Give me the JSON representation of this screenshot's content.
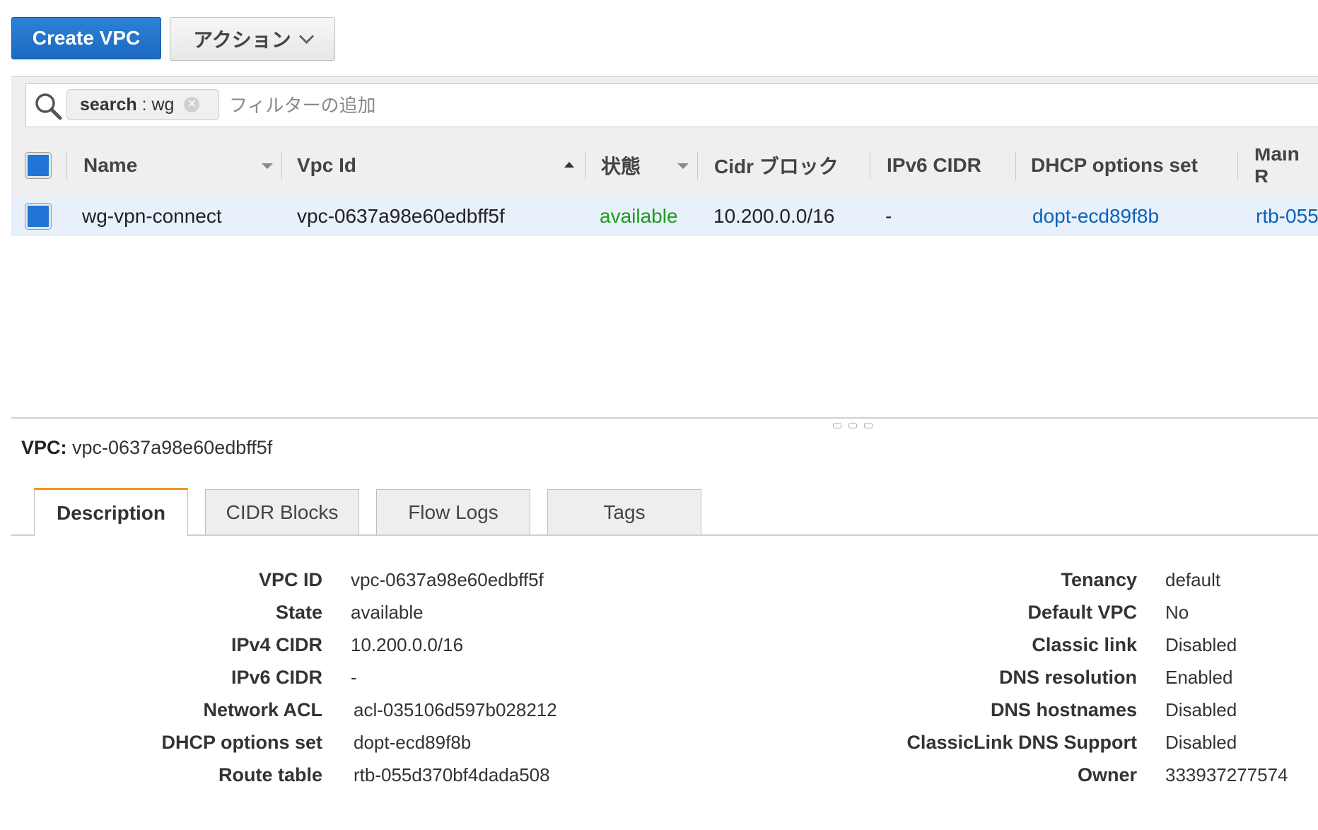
{
  "toolbar": {
    "create_label": "Create VPC",
    "actions_label": "アクション"
  },
  "search": {
    "chip_key": "search",
    "chip_sep": " : ",
    "chip_value": "wg",
    "placeholder": "フィルターの追加"
  },
  "table": {
    "columns": [
      "Name",
      "Vpc Id",
      "状態",
      "Cidr ブロック",
      "IPv6 CIDR",
      "DHCP options set",
      "Main R"
    ],
    "rows": [
      {
        "name": "wg-vpn-connect",
        "vpc_id": "vpc-0637a98e60edbff5f",
        "state": "available",
        "cidr": "10.200.0.0/16",
        "ipv6": "-",
        "dhcp": "dopt-ecd89f8b",
        "main_rt": "rtb-055"
      }
    ]
  },
  "detail": {
    "title_label": "VPC:",
    "title_value": "vpc-0637a98e60edbff5f",
    "tabs": [
      "Description",
      "CIDR Blocks",
      "Flow Logs",
      "Tags"
    ],
    "left": [
      {
        "label": "VPC ID",
        "value": "vpc-0637a98e60edbff5f"
      },
      {
        "label": "State",
        "value": "available"
      },
      {
        "label": "IPv4 CIDR",
        "value": "10.200.0.0/16"
      },
      {
        "label": "IPv6 CIDR",
        "value": "-"
      },
      {
        "label": "Network ACL",
        "value": "acl-035106d597b028212"
      },
      {
        "label": "DHCP options set",
        "value": "dopt-ecd89f8b"
      },
      {
        "label": "Route table",
        "value": "rtb-055d370bf4dada508"
      }
    ],
    "right": [
      {
        "label": "Tenancy",
        "value": "default"
      },
      {
        "label": "Default VPC",
        "value": "No"
      },
      {
        "label": "Classic link",
        "value": "Disabled"
      },
      {
        "label": "DNS resolution",
        "value": "Enabled"
      },
      {
        "label": "DNS hostnames",
        "value": "Disabled"
      },
      {
        "label": "ClassicLink DNS Support",
        "value": "Disabled"
      },
      {
        "label": "Owner",
        "value": "333937277574"
      }
    ]
  },
  "colors": {
    "primary": "#1f74d6",
    "link": "#0a63b8",
    "status_ok": "#1d9a1d",
    "tab_accent": "#f0981e"
  }
}
